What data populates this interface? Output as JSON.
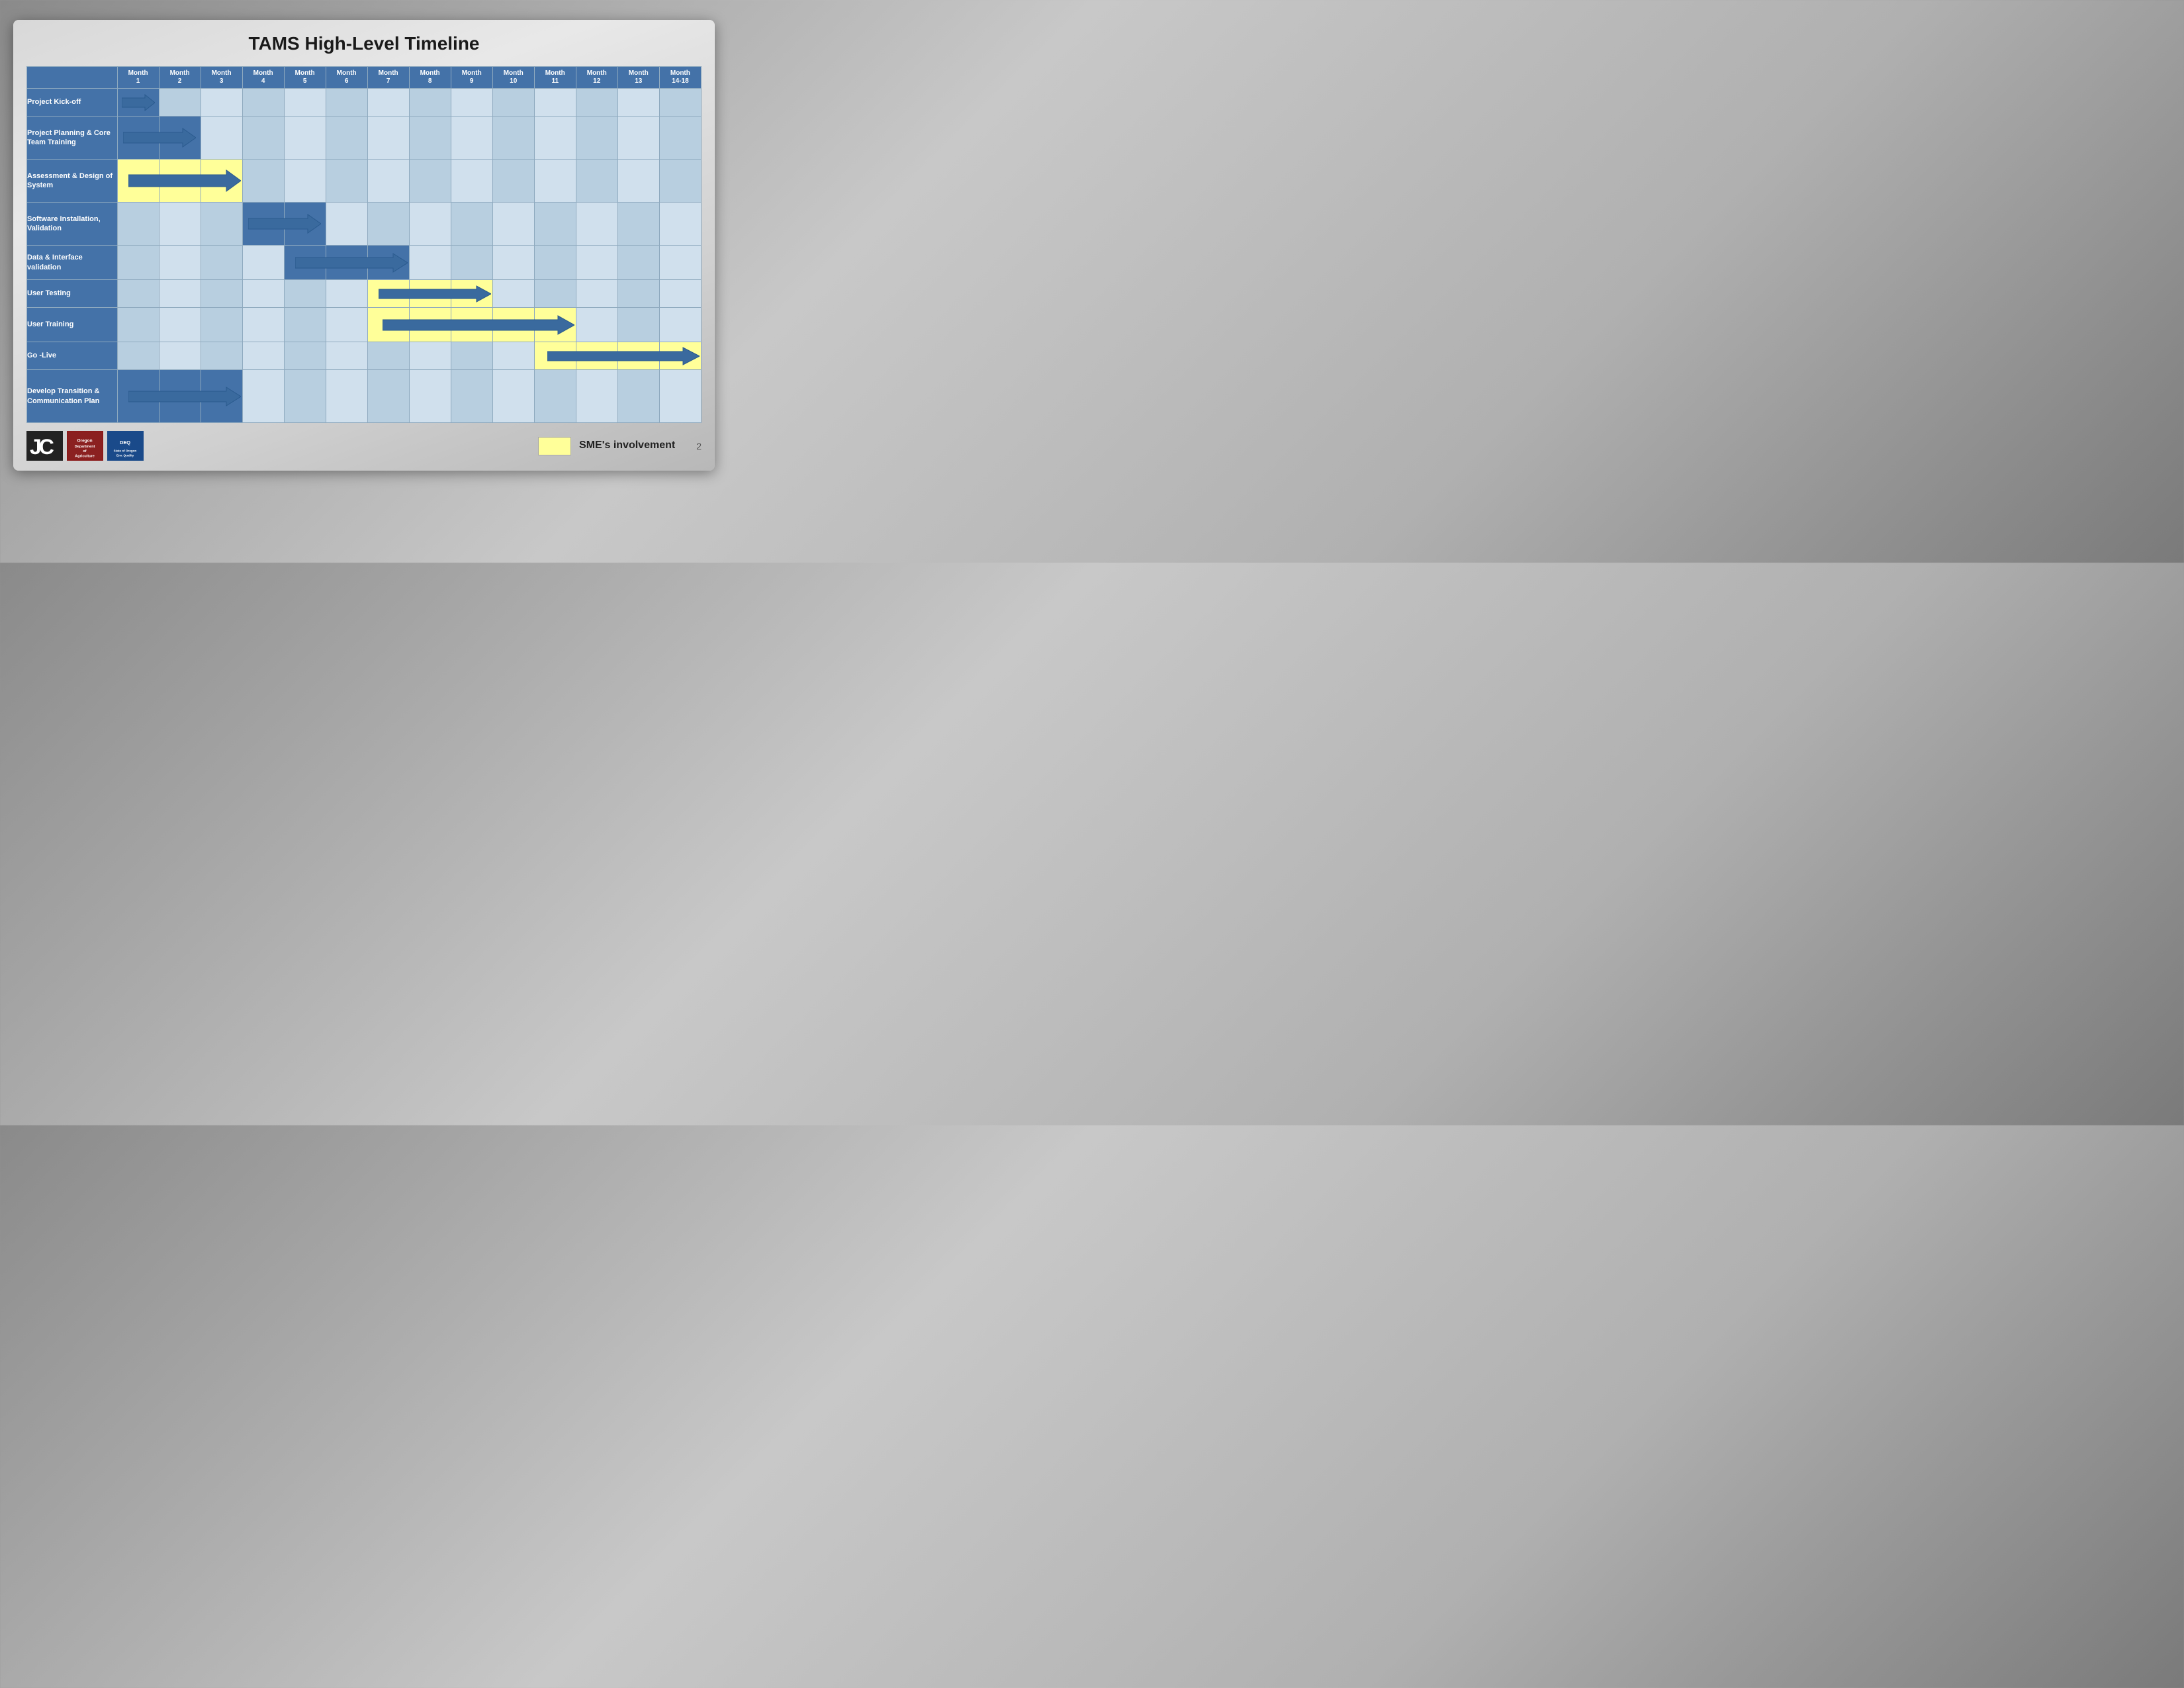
{
  "title": "TAMS High-Level Timeline",
  "months": [
    {
      "label": "Month",
      "sub": "1"
    },
    {
      "label": "Month",
      "sub": "2"
    },
    {
      "label": "Month",
      "sub": "3"
    },
    {
      "label": "Month",
      "sub": "4"
    },
    {
      "label": "Month",
      "sub": "5"
    },
    {
      "label": "Month",
      "sub": "6"
    },
    {
      "label": "Month",
      "sub": "7"
    },
    {
      "label": "Month",
      "sub": "8"
    },
    {
      "label": "Month",
      "sub": "9"
    },
    {
      "label": "Month",
      "sub": "10"
    },
    {
      "label": "Month",
      "sub": "11"
    },
    {
      "label": "Month",
      "sub": "12"
    },
    {
      "label": "Month",
      "sub": "13"
    },
    {
      "label": "Month",
      "sub": "14-18"
    }
  ],
  "tasks": [
    {
      "id": "kickoff",
      "label": "Project Kick-off",
      "arrow_start": 0,
      "arrow_end": 0,
      "yellow": false
    },
    {
      "id": "planning",
      "label": "Project Planning & Core Team Training",
      "arrow_start": 0,
      "arrow_end": 1,
      "yellow": false
    },
    {
      "id": "assessment",
      "label": "Assessment & Design of System",
      "arrow_start": 0,
      "arrow_end": 2,
      "yellow": true
    },
    {
      "id": "software",
      "label": "Software Installation, Validation",
      "arrow_start": 3,
      "arrow_end": 4,
      "yellow": false
    },
    {
      "id": "data",
      "label": "Data & Interface validation",
      "arrow_start": 4,
      "arrow_end": 6,
      "yellow": false
    },
    {
      "id": "usertesting",
      "label": "User Testing",
      "arrow_start": 6,
      "arrow_end": 8,
      "yellow": true
    },
    {
      "id": "usertraining",
      "label": "User Training",
      "arrow_start": 6,
      "arrow_end": 10,
      "yellow": true
    },
    {
      "id": "golive",
      "label": "Go -Live",
      "arrow_start": 10,
      "arrow_end": 13,
      "yellow": true
    },
    {
      "id": "develop",
      "label": "Develop Transition & Communication Plan",
      "arrow_start": 0,
      "arrow_end": 2,
      "yellow": false
    }
  ],
  "legend": {
    "label": "SME's\ninvolvement"
  },
  "page_number": "2"
}
